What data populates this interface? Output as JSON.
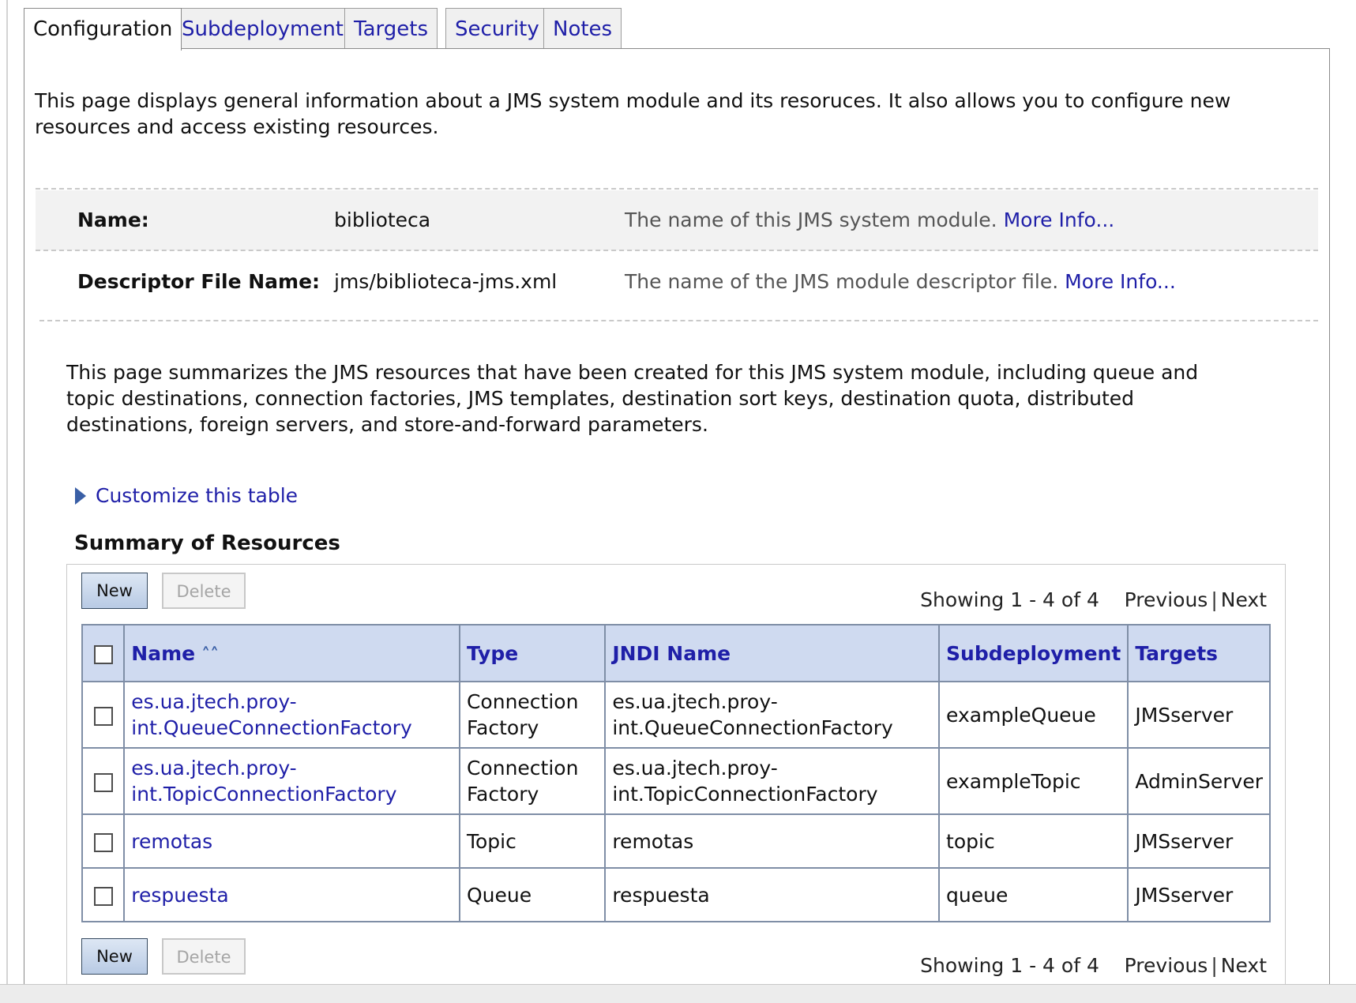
{
  "tabs": [
    {
      "label": "Configuration",
      "active": true
    },
    {
      "label": "Subdeployments"
    },
    {
      "label": "Targets"
    },
    {
      "label": "Security"
    },
    {
      "label": "Notes"
    }
  ],
  "intro": "This page displays general information about a JMS system module and its resoruces. It also allows you to configure new resources and access existing resources.",
  "properties": {
    "name": {
      "label": "Name:",
      "value": "biblioteca",
      "help": "The name of this JMS system module.",
      "more": "More Info..."
    },
    "descriptor": {
      "label": "Descriptor File Name:",
      "value": "jms/biblioteca-jms.xml",
      "help": "The name of the JMS module descriptor file.",
      "more": "More Info..."
    }
  },
  "summary_text": "This page summarizes the JMS resources that have been created for this JMS system module, including queue and topic destinations, connection factories, JMS templates, destination sort keys, destination quota, distributed destinations, foreign servers, and store-and-forward parameters.",
  "customize_label": "Customize this table",
  "table_title": "Summary of Resources",
  "buttons": {
    "new": "New",
    "delete": "Delete"
  },
  "pager": {
    "showing": "Showing 1 - 4 of 4",
    "previous": "Previous",
    "separator": "|",
    "next": "Next"
  },
  "columns": [
    "Name",
    "Type",
    "JNDI Name",
    "Subdeployment",
    "Targets"
  ],
  "rows": [
    {
      "name_1": "es.ua.jtech.proy-",
      "name_2": "int.QueueConnectionFactory",
      "type_1": "Connection",
      "type_2": "Factory",
      "jndi_1": "es.ua.jtech.proy-",
      "jndi_2": "int.QueueConnectionFactory",
      "subdeployment": "exampleQueue",
      "targets": "JMSserver"
    },
    {
      "name_1": "es.ua.jtech.proy-",
      "name_2": "int.TopicConnectionFactory",
      "type_1": "Connection",
      "type_2": "Factory",
      "jndi_1": "es.ua.jtech.proy-",
      "jndi_2": "int.TopicConnectionFactory",
      "subdeployment": "exampleTopic",
      "targets": "AdminServer"
    },
    {
      "name_1": "remotas",
      "type_1": "Topic",
      "jndi_1": "remotas",
      "subdeployment": "topic",
      "targets": "JMSserver"
    },
    {
      "name_1": "respuesta",
      "type_1": "Queue",
      "jndi_1": "respuesta",
      "subdeployment": "queue",
      "targets": "JMSserver"
    }
  ],
  "colors": {
    "link": "#1f1fa8",
    "header_bg": "#cfdaf0",
    "border": "#7f8ea6"
  }
}
